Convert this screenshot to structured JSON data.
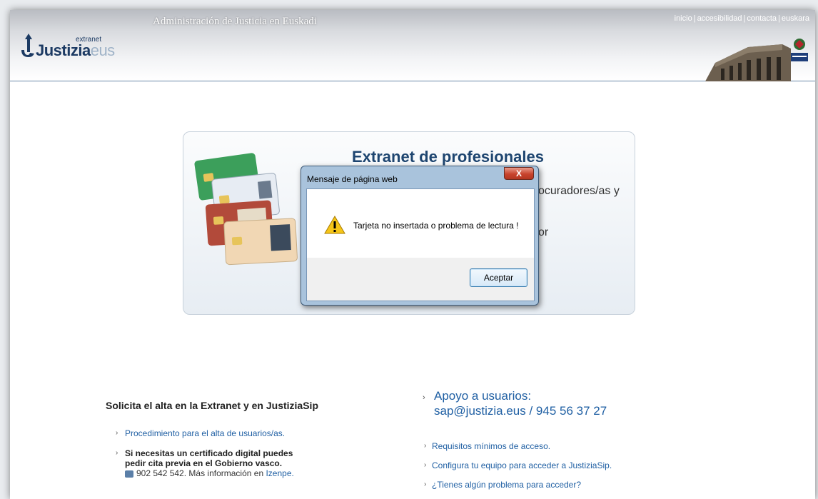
{
  "header": {
    "title": "Administración de Justicia en Euskadi",
    "links": [
      "inicio",
      "accesibilidad",
      "contacta",
      "euskara"
    ],
    "logo": {
      "main": "Justizia",
      "suffix": "eus",
      "tag": "extranet"
    }
  },
  "card": {
    "title": "Extranet de profesionales",
    "text_partial_1": "ocuradores/as y",
    "text_partial_2": "or"
  },
  "dialog": {
    "title": "Mensaje de página web",
    "close_label": "X",
    "message": "Tarjeta no insertada o problema de lectura !",
    "ok_label": "Aceptar"
  },
  "left": {
    "heading": "Solicita el alta en la Extranet y en JustiziaSip",
    "link1": "Procedimiento para el alta de usuarios/as.",
    "bold_line1": "Si necesitas un certificado digital puedes",
    "bold_line2": "pedir cita previa en el Gobierno vasco.",
    "phone_text": "902 542 542. Más información en",
    "phone_link": "Izenpe."
  },
  "right": {
    "support_line1": "Apoyo a usuarios:",
    "support_line2": "sap@justizia.eus / 945 56 37 27",
    "links": [
      "Requisitos mínimos de acceso.",
      "Configura tu equipo para acceder a JustiziaSip.",
      "¿Tienes algún problema para acceder?"
    ]
  },
  "colors": {
    "brand_blue": "#1e4570",
    "link_blue": "#1f5fa3",
    "dialog_frame": "#a9c3dc",
    "close_red": "#c8432d"
  },
  "icons": [
    "justizia-logo-icon",
    "building-image",
    "gobierno-vasco-logo-icon",
    "id-cards-image",
    "warning-icon",
    "phone-icon"
  ]
}
